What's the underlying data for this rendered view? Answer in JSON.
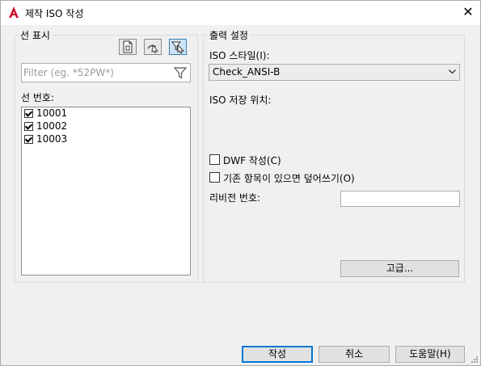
{
  "window": {
    "title": "제작 ISO 작성",
    "close_symbol": "✕"
  },
  "left_panel": {
    "group_label": "선 표시",
    "toolbar": [
      {
        "icon": "document-icon",
        "active": false
      },
      {
        "icon": "select-object-icon",
        "active": false
      },
      {
        "icon": "filter-select-icon",
        "active": true
      }
    ],
    "filter_placeholder": "Filter (eg. *52PW*)",
    "list_label": "선 번호:",
    "lines": [
      {
        "label": "10001",
        "checked": true
      },
      {
        "label": "10002",
        "checked": true
      },
      {
        "label": "10003",
        "checked": true
      }
    ]
  },
  "right_panel": {
    "group_label": "출력 설정",
    "style_label": "ISO 스타일(I):",
    "style_value": "Check_ANSI-B",
    "location_label": "ISO 저장 위치:",
    "dwf_label": "DWF 작성(C)",
    "dwf_checked": false,
    "overwrite_label": "기존 항목이 있으면 덮어쓰기(O)",
    "overwrite_checked": false,
    "revision_label": "리비전 번호:",
    "revision_value": "",
    "advanced_button": "고급..."
  },
  "footer": {
    "create_button": "작성",
    "cancel_button": "취소",
    "help_button": "도움말(H)"
  },
  "colors": {
    "app_icon": "#c8102e",
    "default_button_border": "#0078d7",
    "active_tool_fill": "#cce4f7",
    "dialog_bg": "#f0f0f0"
  }
}
